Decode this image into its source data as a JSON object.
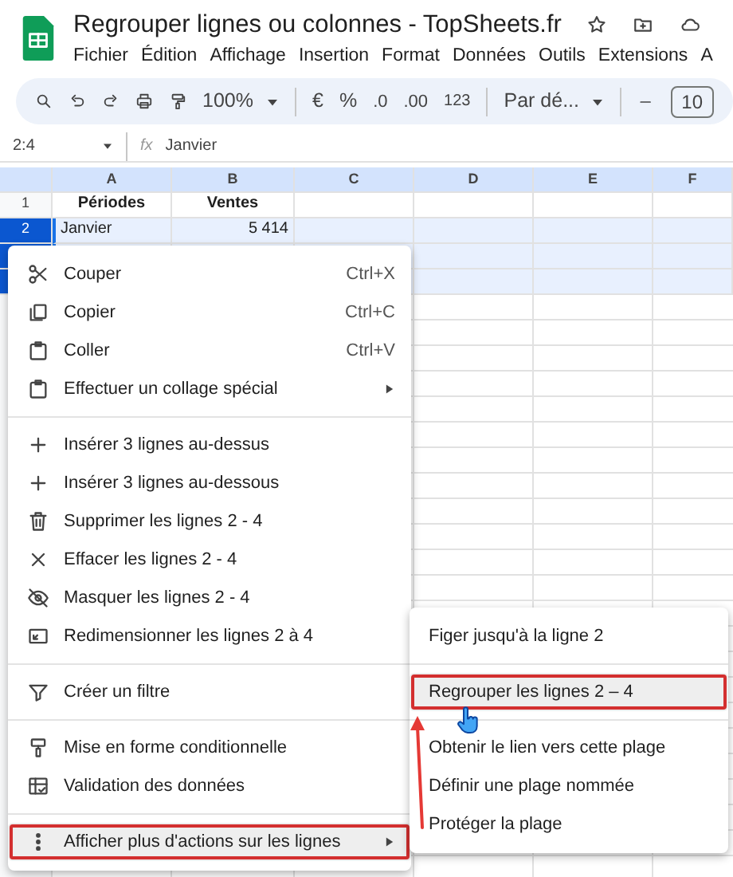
{
  "document": {
    "title": "Regrouper lignes ou colonnes - TopSheets.fr"
  },
  "menu_bar": [
    "Fichier",
    "Édition",
    "Affichage",
    "Insertion",
    "Format",
    "Données",
    "Outils",
    "Extensions",
    "A"
  ],
  "toolbar": {
    "zoom": "100%",
    "currency": "€",
    "percent": "%",
    "decrease_decimals": ".0",
    "increase_decimals": ".00",
    "number_format": "123",
    "font": "Par dé...",
    "font_size": "10"
  },
  "formula_bar": {
    "cell_range": "2:4",
    "function_label": "fx",
    "formula": "Janvier"
  },
  "columns": [
    "A",
    "B",
    "C",
    "D",
    "E",
    "F"
  ],
  "rows": [
    {
      "number": "1",
      "selected": false,
      "cells": [
        "Périodes",
        "Ventes"
      ]
    },
    {
      "number": "2",
      "selected": true,
      "cells": [
        "Janvier",
        "5 414"
      ]
    },
    {
      "selected": true
    },
    {
      "selected": true
    }
  ],
  "context_menu": {
    "items": [
      {
        "kind": "item",
        "label": "Couper",
        "shortcut": "Ctrl+X",
        "submenu": false,
        "highlighted": false
      },
      {
        "kind": "item",
        "label": "Copier",
        "shortcut": "Ctrl+C",
        "submenu": false,
        "highlighted": false
      },
      {
        "kind": "item",
        "label": "Coller",
        "shortcut": "Ctrl+V",
        "submenu": false,
        "highlighted": false
      },
      {
        "kind": "item",
        "label": "Effectuer un collage spécial",
        "submenu": true,
        "highlighted": false
      },
      {
        "kind": "divider"
      },
      {
        "kind": "item",
        "label": "Insérer 3 lignes au-dessus",
        "submenu": false,
        "highlighted": false
      },
      {
        "kind": "item",
        "label": "Insérer 3 lignes au-dessous",
        "submenu": false,
        "highlighted": false
      },
      {
        "kind": "item",
        "label": "Supprimer les lignes 2 - 4",
        "submenu": false,
        "highlighted": false
      },
      {
        "kind": "item",
        "label": "Effacer les lignes 2 - 4",
        "submenu": false,
        "highlighted": false
      },
      {
        "kind": "item",
        "label": "Masquer les lignes 2 - 4",
        "submenu": false,
        "highlighted": false
      },
      {
        "kind": "item",
        "label": "Redimensionner les lignes 2 à 4",
        "submenu": false,
        "highlighted": false
      },
      {
        "kind": "divider"
      },
      {
        "kind": "item",
        "label": "Créer un filtre",
        "submenu": false,
        "highlighted": false
      },
      {
        "kind": "divider"
      },
      {
        "kind": "item",
        "label": "Mise en forme conditionnelle",
        "submenu": false,
        "highlighted": false
      },
      {
        "kind": "item",
        "label": "Validation des données",
        "submenu": false,
        "highlighted": false
      },
      {
        "kind": "divider"
      },
      {
        "kind": "item",
        "label": "Afficher plus d'actions sur les lignes",
        "submenu": true,
        "highlighted": true
      }
    ]
  },
  "submenu": {
    "items": [
      {
        "kind": "item",
        "label": "Figer jusqu'à la ligne 2",
        "highlighted": false
      },
      {
        "kind": "divider"
      },
      {
        "kind": "item",
        "label": "Regrouper les lignes 2 – 4",
        "highlighted": true
      },
      {
        "kind": "divider"
      },
      {
        "kind": "item",
        "label": "Obtenir le lien vers cette plage",
        "highlighted": false
      },
      {
        "kind": "item",
        "label": "Définir une plage nommée",
        "highlighted": false
      },
      {
        "kind": "item",
        "label": "Protéger la plage",
        "highlighted": false
      }
    ]
  }
}
